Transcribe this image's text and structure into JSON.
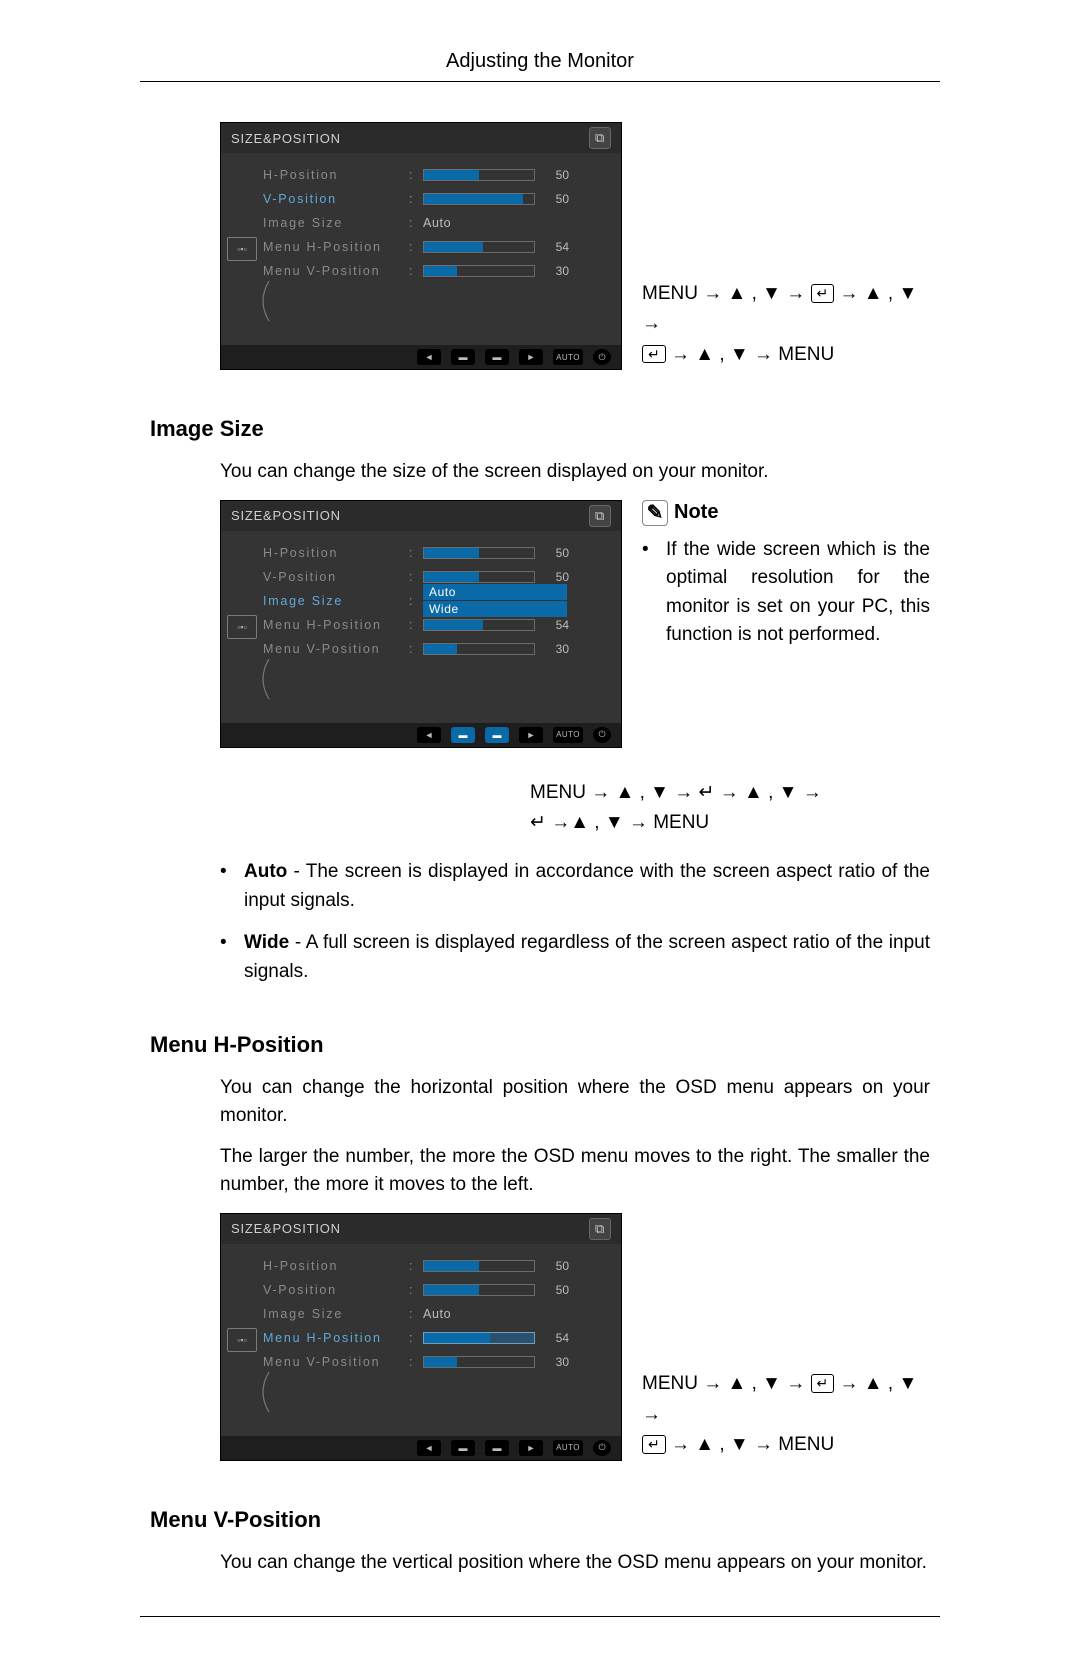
{
  "page": {
    "title": "Adjusting the Monitor"
  },
  "nav": {
    "menu": "MENU",
    "arrow": "→",
    "up": "▲",
    "down": "▼",
    "sep": " , ",
    "enter_glyph": "↵"
  },
  "osd_common": {
    "title": "SIZE&POSITION",
    "icon_label": "▫▪▫",
    "footer": {
      "b1": "◄",
      "b2": "▬",
      "b3": "▬",
      "b4": "►",
      "auto": "AUTO",
      "power": "⏻"
    },
    "corner_glyph": "⧉"
  },
  "osd1": {
    "active_index": 1,
    "rows": [
      {
        "label": "H-Position",
        "type": "bar",
        "fill": 50,
        "value": "50"
      },
      {
        "label": "V-Position",
        "type": "bar",
        "fill": 90,
        "value": "50"
      },
      {
        "label": "Image Size",
        "type": "text",
        "text": "Auto"
      },
      {
        "label": "Menu H-Position",
        "type": "bar",
        "fill": 54,
        "value": "54"
      },
      {
        "label": "Menu V-Position",
        "type": "bar",
        "fill": 30,
        "value": "30"
      }
    ]
  },
  "section_image_size": {
    "heading": "Image Size",
    "intro": "You can change the size of the screen displayed on your monitor."
  },
  "osd2": {
    "active_index": 2,
    "rows": [
      {
        "label": "H-Position",
        "type": "bar",
        "fill": 50,
        "value": "50"
      },
      {
        "label": "V-Position",
        "type": "bar",
        "fill": 50,
        "value": "50"
      },
      {
        "label": "Image Size",
        "type": "dropdown",
        "options": [
          "Auto",
          "Wide"
        ]
      },
      {
        "label": "Menu H-Position",
        "type": "bar",
        "fill": 54,
        "value": "54"
      },
      {
        "label": "Menu V-Position",
        "type": "bar",
        "fill": 30,
        "value": "30"
      }
    ]
  },
  "note": {
    "heading": "Note",
    "glyph": "✎",
    "text": "If the wide screen which is the optimal resolution for the monitor is set on your PC, this function is not performed."
  },
  "bullets_image_size": [
    {
      "term": "Auto",
      "rest": " - The screen is displayed in accordance with the screen aspect ratio of the input signals."
    },
    {
      "term": "Wide",
      "rest": " - A full screen is displayed regardless of the screen aspect ratio of the input signals."
    }
  ],
  "section_menu_h": {
    "heading": "Menu H-Position",
    "p1": "You can change the horizontal position where the OSD menu appears on your monitor.",
    "p2": "The larger the number, the more the OSD menu moves to the right. The smaller the number, the more it moves to the left."
  },
  "osd3": {
    "active_index": 3,
    "rows": [
      {
        "label": "H-Position",
        "type": "bar",
        "fill": 50,
        "value": "50"
      },
      {
        "label": "V-Position",
        "type": "bar",
        "fill": 50,
        "value": "50"
      },
      {
        "label": "Image Size",
        "type": "text",
        "text": "Auto"
      },
      {
        "label": "Menu H-Position",
        "type": "bar",
        "fill": 60,
        "value": "54",
        "barSel": true
      },
      {
        "label": "Menu V-Position",
        "type": "bar",
        "fill": 30,
        "value": "30"
      }
    ]
  },
  "section_menu_v": {
    "heading": "Menu V-Position",
    "p1": "You can change the vertical position where the OSD menu appears on your monitor."
  }
}
